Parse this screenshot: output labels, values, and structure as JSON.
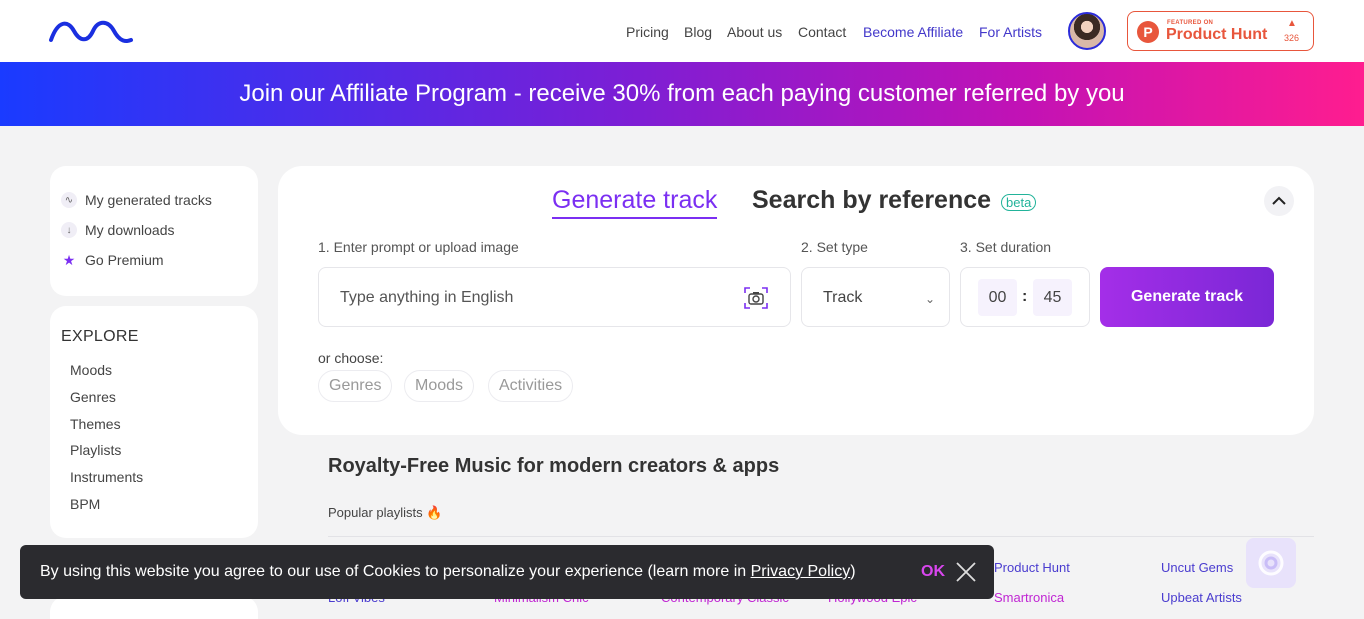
{
  "header": {
    "nav": [
      "Pricing",
      "Blog",
      "About us",
      "Contact",
      "Become Affiliate",
      "For Artists"
    ],
    "product_hunt": {
      "featured": "FEATURED ON",
      "name": "Product Hunt",
      "count": "326"
    }
  },
  "banner": {
    "text": "Join our Affiliate Program - receive 30% from each paying customer referred by you"
  },
  "sidebar": {
    "links": [
      "My generated tracks",
      "My downloads",
      "Go Premium"
    ],
    "explore_title": "EXPLORE",
    "explore_items": [
      "Moods",
      "Genres",
      "Themes",
      "Playlists",
      "Instruments",
      "BPM"
    ]
  },
  "generator": {
    "tab_generate": "Generate track",
    "tab_reference": "Search by reference",
    "beta": "beta",
    "step1": "1. Enter prompt or upload image",
    "step2": "2. Set type",
    "step3": "3. Set duration",
    "prompt_placeholder": "Type anything in English",
    "type_value": "Track",
    "minutes": "00",
    "seconds": "45",
    "generate_button": "Generate track",
    "or_choose": "or choose:",
    "chips": [
      "Genres",
      "Moods",
      "Activities"
    ]
  },
  "content": {
    "section_title": "Royalty-Free Music for modern creators & apps",
    "popular_label": "Popular playlists",
    "playlists_row1": [
      "Product Hunt",
      "Uncut Gems"
    ],
    "playlists_row2": [
      "Lofi Vibes",
      "Minimalism Chic",
      "Contemporary Classic",
      "Hollywood Epic",
      "Smartronica",
      "Upbeat Artists"
    ]
  },
  "cookie": {
    "text_before": "By using this website you agree to our use of Cookies to personalize your experience (learn more in ",
    "link": "Privacy Policy",
    "text_after": ")",
    "ok": "OK"
  },
  "colors": {
    "accent": "#7b2ff2",
    "affiliate": "#4338ca",
    "product_hunt": "#e8563c"
  }
}
